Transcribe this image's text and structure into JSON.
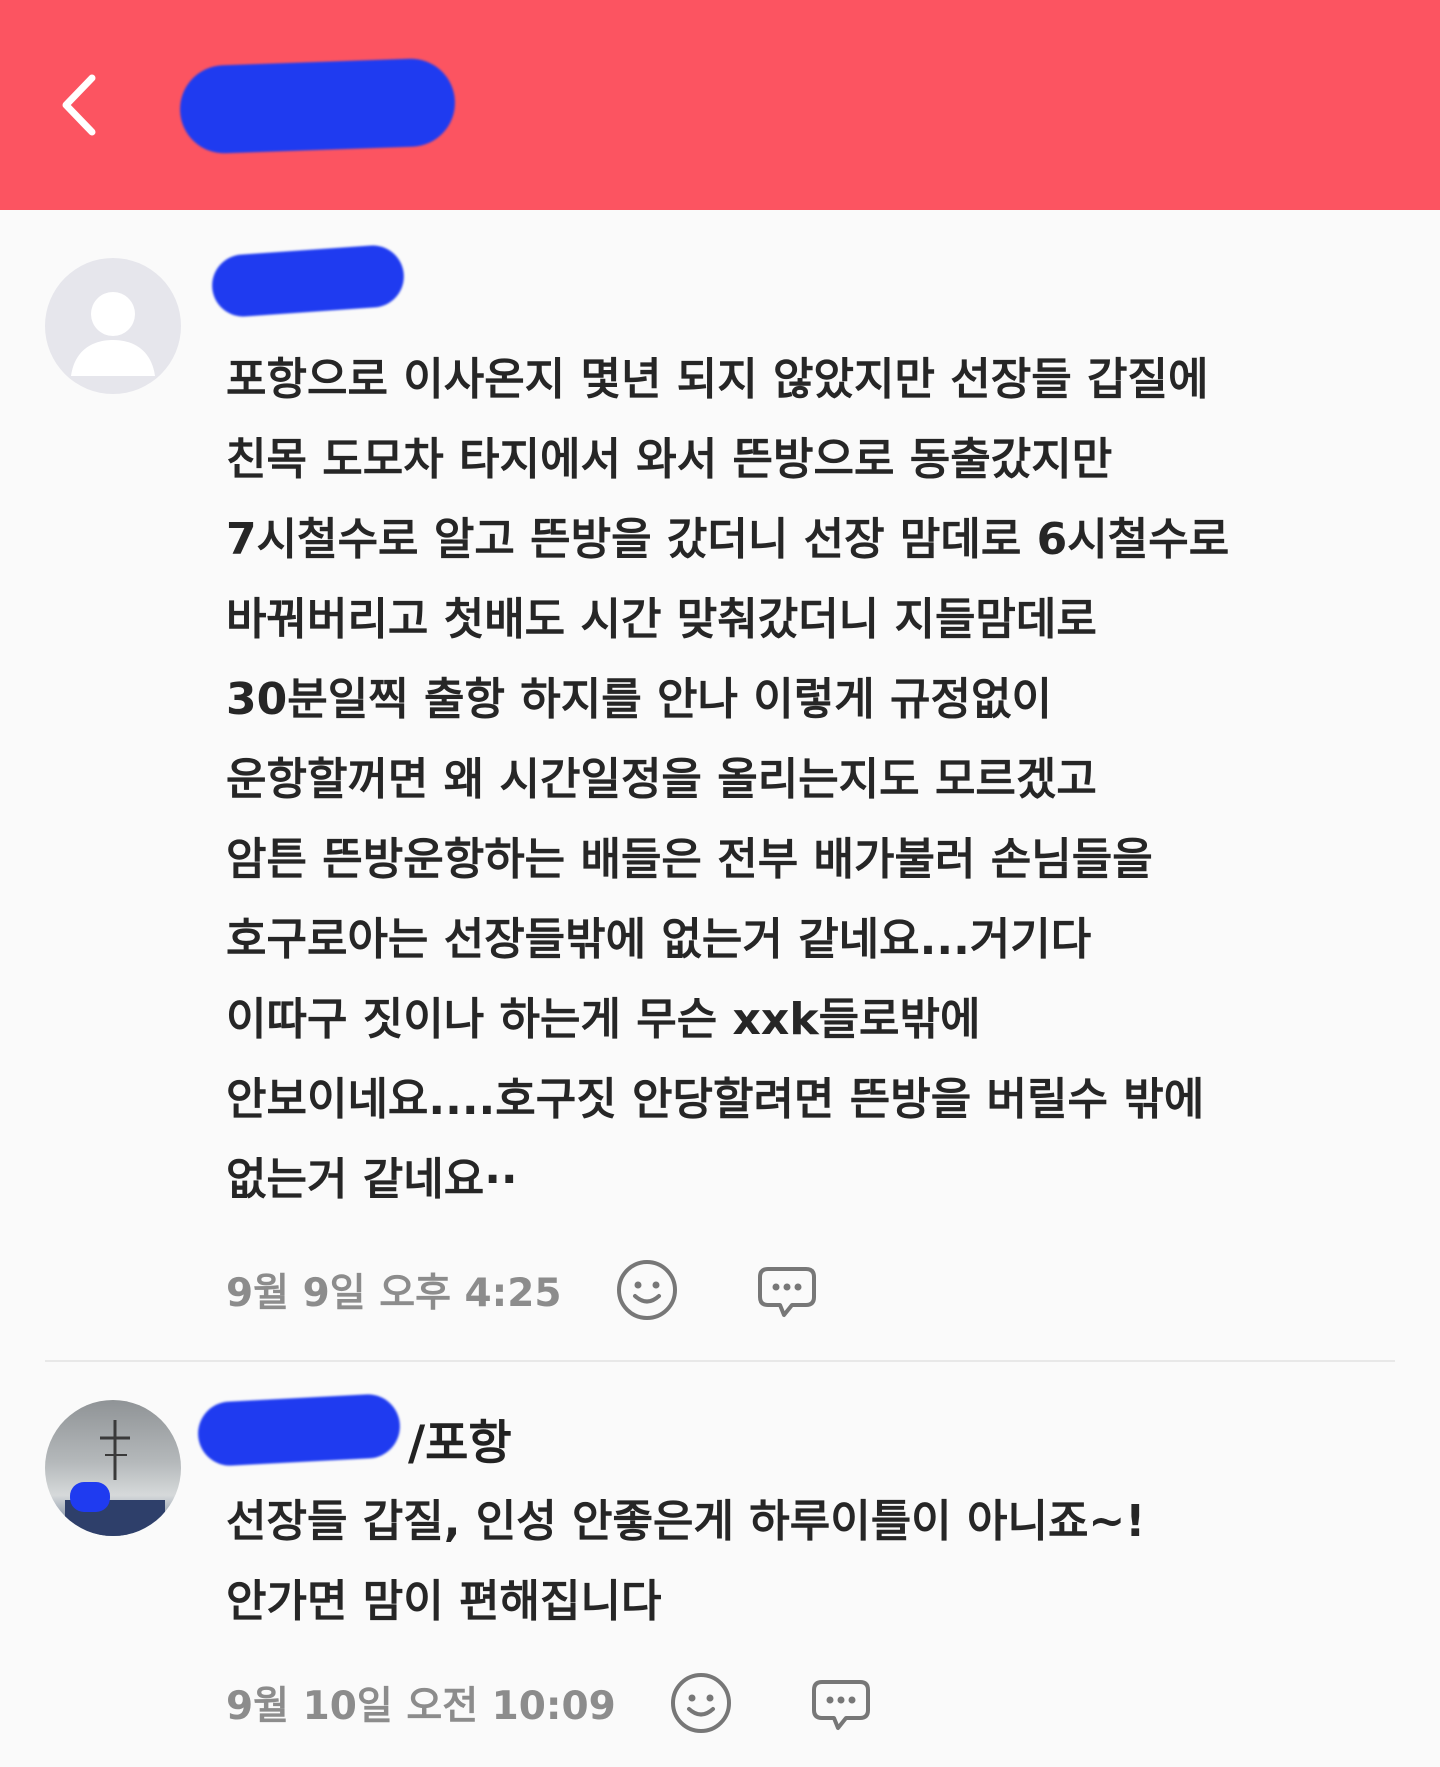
{
  "colors": {
    "header_bg": "#fc5461",
    "redaction": "#1f3bf0",
    "timestamp": "#8c8c8c"
  },
  "header": {
    "back_icon": "chevron-left-icon"
  },
  "comments": [
    {
      "avatar": "default-user-avatar",
      "lines": [
        "포항으로  이사온지 몇년 되지 않았지만  선장들 갑질에",
        "친목 도모차 타지에서 와서 뜬방으로 동출갔지만",
        "7시철수로 알고 뜬방을 갔더니 선장 맘데로 6시철수로",
        "바꿔버리고  첫배도 시간 맞춰갔더니  지들맘데로",
        "30분일찍 출항 하지를 안나   이렇게 규정없이",
        "운항할꺼면  왜 시간일정을  올리는지도 모르겠고",
        "암튼 뜬방운항하는 배들은 전부 배가불러  손님들을",
        "호구로아는  선장들밖에  없는거  같네요...거기다",
        "이따구 짓이나  하는게  무슨  xxk들로밖에",
        "안보이네요....호구짓  안당할려면 뜬방을  버릴수 밖에",
        "없는거 같네요··"
      ],
      "timestamp": "9월 9일 오후 4:25",
      "reaction_icon": "smiley-icon",
      "reply_icon": "chat-bubble-icon"
    },
    {
      "avatar": "photo-avatar",
      "author_suffix": "/포항",
      "lines": [
        "선장들 갑질, 인성 안좋은게 하루이틀이 아니죠~!",
        "안가면 맘이 편해집니다"
      ],
      "timestamp": "9월 10일 오전 10:09",
      "reaction_icon": "smiley-icon",
      "reply_icon": "chat-bubble-icon"
    }
  ]
}
